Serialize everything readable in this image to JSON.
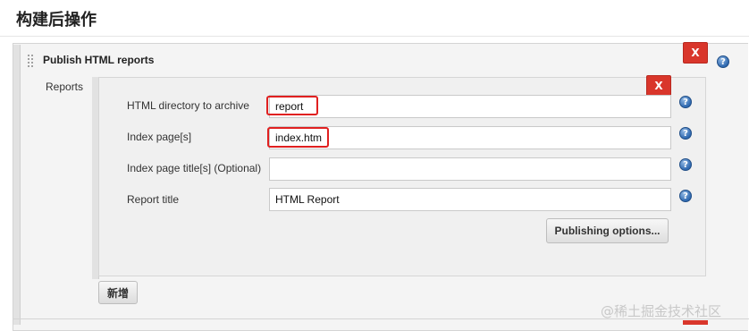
{
  "section": {
    "title": "构建后操作"
  },
  "publisher": {
    "heading": "Publish HTML reports",
    "delete_label": "X",
    "help_label": "?"
  },
  "reports": {
    "label": "Reports",
    "delete_label": "X",
    "fields": [
      {
        "label": "HTML directory to archive",
        "value": "report",
        "placeholder": ""
      },
      {
        "label": "Index page[s]",
        "value": "index.htm",
        "placeholder": ""
      },
      {
        "label": "Index page title[s] (Optional)",
        "value": "",
        "placeholder": ""
      },
      {
        "label": "Report title",
        "value": "HTML Report",
        "placeholder": ""
      }
    ],
    "help_label": "?",
    "publishing_options_label": "Publishing options...",
    "add_label": "新增"
  },
  "watermark": "@稀土掘金技术社区",
  "colors": {
    "delete_red": "#d9362b",
    "highlight_red": "#e02020",
    "help_blue": "#2f69b0"
  },
  "icons": [
    "drag-handle-icon",
    "help-icon"
  ]
}
